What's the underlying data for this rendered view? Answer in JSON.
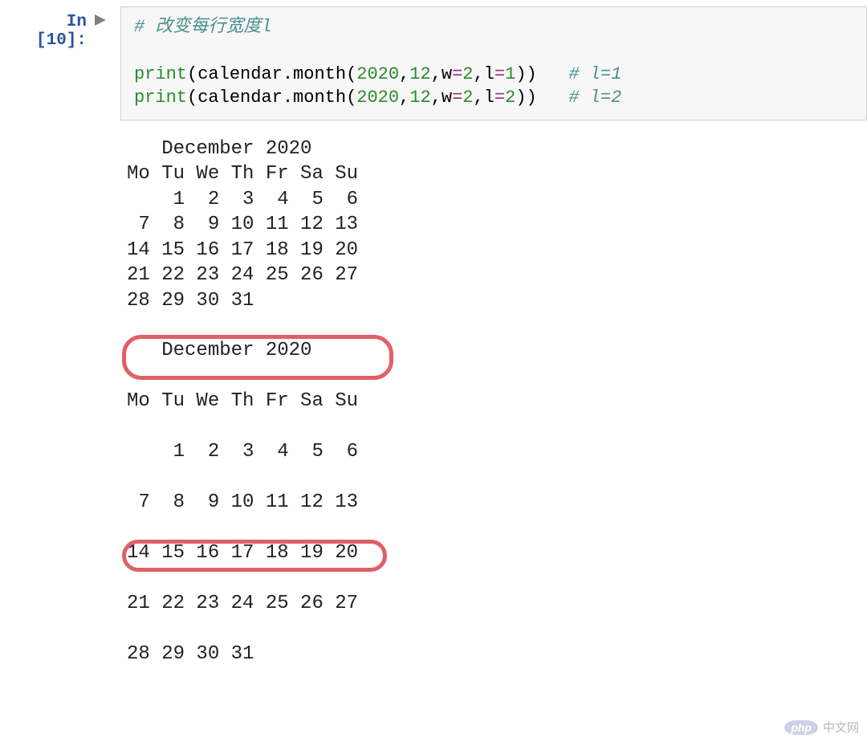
{
  "prompt": {
    "label": "In [10]:"
  },
  "code": {
    "line1": {
      "comment": "# 改变每行宽度l"
    },
    "line3": {
      "func": "print",
      "p1": "(",
      "name1": "calendar",
      "dot": ".",
      "name2": "month",
      "p2": "(",
      "n1": "2020",
      "c1": ",",
      "n2": "12",
      "c2": ",",
      "kw1": "w",
      "op1": "=",
      "kv1": "2",
      "c3": ",",
      "kw2": "l",
      "op2": "=",
      "kv2": "1",
      "p3": ")",
      "p4": ")",
      "comment": "# l=1"
    },
    "line4": {
      "func": "print",
      "p1": "(",
      "name1": "calendar",
      "dot": ".",
      "name2": "month",
      "p2": "(",
      "n1": "2020",
      "c1": ",",
      "n2": "12",
      "c2": ",",
      "kw1": "w",
      "op1": "=",
      "kv1": "2",
      "c3": ",",
      "kw2": "l",
      "op2": "=",
      "kv2": "2",
      "p3": ")",
      "p4": ")",
      "comment": "# l=2"
    }
  },
  "output": {
    "cal1": {
      "title": "   December 2020",
      "header": "Mo Tu We Th Fr Sa Su",
      "w1": "    1  2  3  4  5  6",
      "w2": " 7  8  9 10 11 12 13",
      "w3": "14 15 16 17 18 19 20",
      "w4": "21 22 23 24 25 26 27",
      "w5": "28 29 30 31"
    },
    "cal2": {
      "title": "   December 2020",
      "header": "Mo Tu We Th Fr Sa Su",
      "w1": "    1  2  3  4  5  6",
      "w2": " 7  8  9 10 11 12 13",
      "w3": "14 15 16 17 18 19 20",
      "w4": "21 22 23 24 25 26 27",
      "w5": "28 29 30 31"
    }
  },
  "watermark": {
    "php": "php",
    "text": "中文网"
  }
}
